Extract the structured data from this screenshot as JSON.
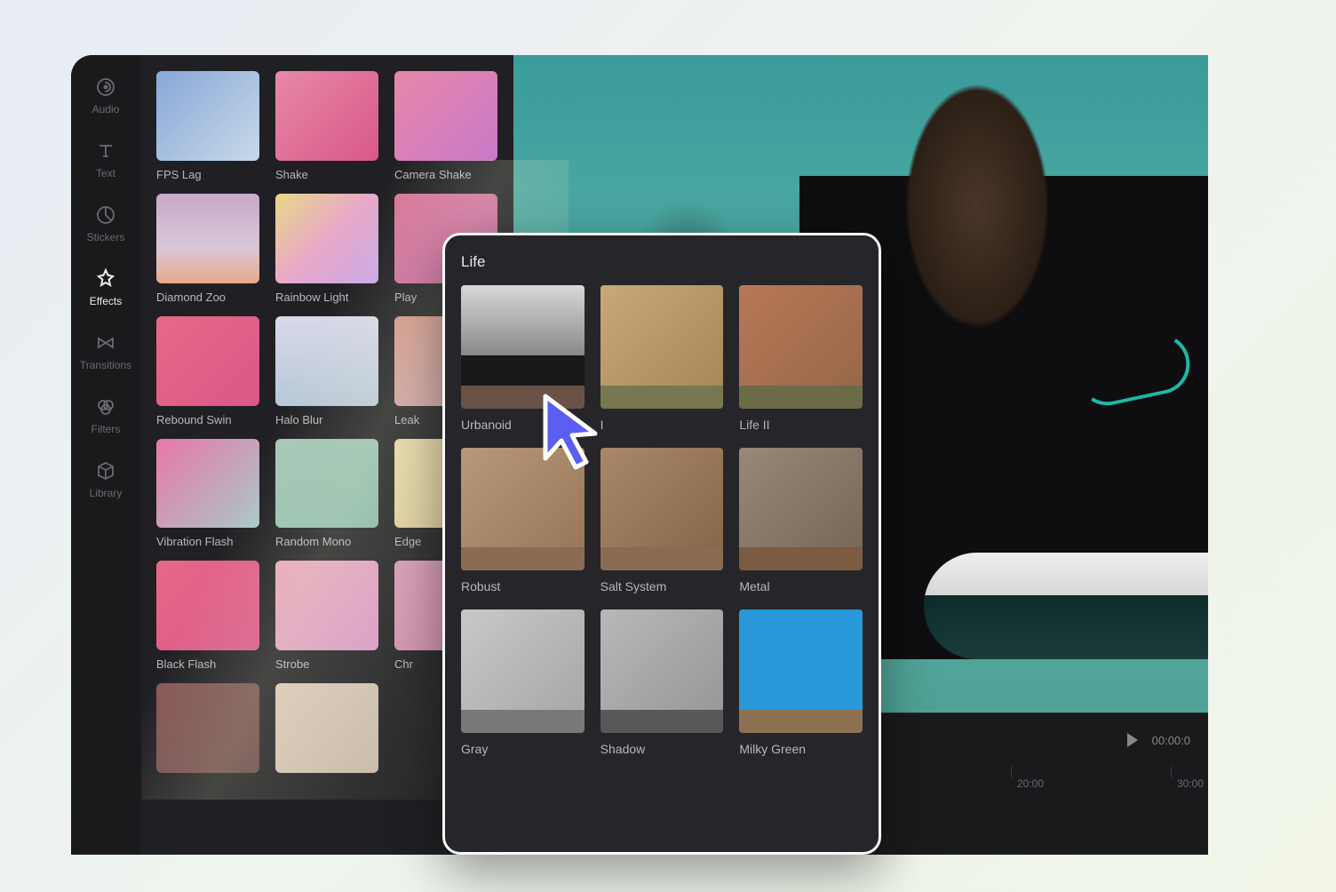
{
  "sidebar": {
    "items": [
      {
        "label": "Audio",
        "icon": "audio"
      },
      {
        "label": "Text",
        "icon": "text"
      },
      {
        "label": "Stickers",
        "icon": "stickers"
      },
      {
        "label": "Effects",
        "icon": "effects",
        "active": true
      },
      {
        "label": "Transitions",
        "icon": "transitions"
      },
      {
        "label": "Filters",
        "icon": "filters"
      },
      {
        "label": "Library",
        "icon": "library"
      }
    ]
  },
  "effects": {
    "items": [
      {
        "label": "FPS Lag"
      },
      {
        "label": "Shake"
      },
      {
        "label": "Camera Shake"
      },
      {
        "label": "Diamond Zoo"
      },
      {
        "label": "Rainbow Light"
      },
      {
        "label": "Play"
      },
      {
        "label": "Rebound Swin"
      },
      {
        "label": "Halo Blur"
      },
      {
        "label": "Leak"
      },
      {
        "label": "Vibration Flash"
      },
      {
        "label": "Random Mono"
      },
      {
        "label": "Edge"
      },
      {
        "label": "Black Flash"
      },
      {
        "label": "Strobe"
      },
      {
        "label": "Chr"
      },
      {
        "label": ""
      },
      {
        "label": ""
      }
    ]
  },
  "popup": {
    "title": "Life",
    "items": [
      {
        "label": "Urbanoid"
      },
      {
        "label": "I"
      },
      {
        "label": "Life II"
      },
      {
        "label": "Robust"
      },
      {
        "label": "Salt System"
      },
      {
        "label": "Metal"
      },
      {
        "label": "Gray"
      },
      {
        "label": "Shadow"
      },
      {
        "label": "Milky Green"
      }
    ]
  },
  "timeline": {
    "timecode": "00:00:0",
    "marks": [
      "20:00",
      "30:00"
    ]
  }
}
